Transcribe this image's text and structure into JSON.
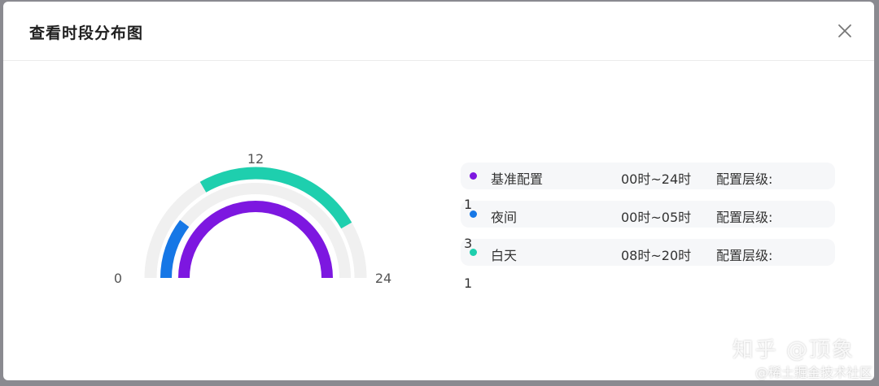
{
  "modal": {
    "title": "查看时段分布图",
    "close_icon": "close-icon"
  },
  "chart_data": {
    "type": "radial-bar",
    "axis": {
      "min": 0,
      "max": 24,
      "ticks": [
        "0",
        "12",
        "24"
      ]
    },
    "track_color": "#f0f0f0",
    "series": [
      {
        "name": "基准配置",
        "start": 0,
        "end": 24,
        "color": "#7d17e0"
      },
      {
        "name": "夜间",
        "start": 0,
        "end": 5,
        "color": "#1677e6"
      },
      {
        "name": "白天",
        "start": 8,
        "end": 20,
        "color": "#1ecfae"
      }
    ]
  },
  "legend": [
    {
      "name": "基准配置",
      "time": "00时~24时",
      "level_label": "配置层级:",
      "color": "#7d17e0"
    },
    {
      "name": "夜间",
      "time": "00时~05时",
      "level_label": "配置层级:",
      "color": "#1677e6"
    },
    {
      "name": "白天",
      "time": "08时~20时",
      "level_label": "配置层级:",
      "color": "#1ecfae"
    }
  ],
  "level_values": [
    "1",
    "3",
    "1"
  ],
  "watermark": {
    "line1": "知乎 @顶象",
    "line2": "@稀土掘金技术社区"
  }
}
